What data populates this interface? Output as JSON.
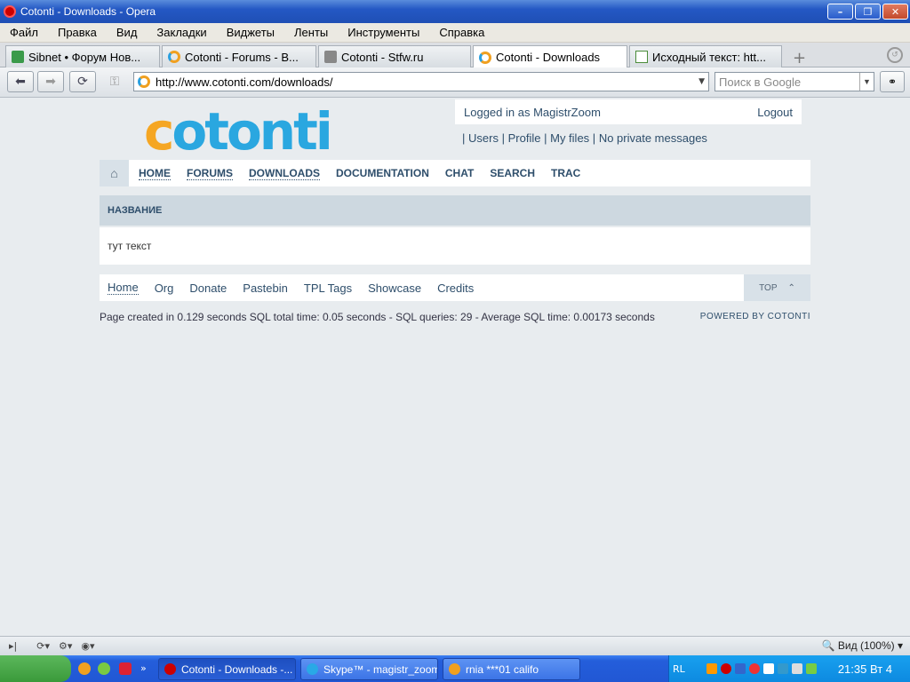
{
  "window": {
    "title": "Cotonti - Downloads - Opera"
  },
  "menu": [
    "Файл",
    "Правка",
    "Вид",
    "Закладки",
    "Виджеты",
    "Ленты",
    "Инструменты",
    "Справка"
  ],
  "tabs": [
    {
      "label": "Sibnet • Форум Нов..."
    },
    {
      "label": "Cotonti - Forums - B..."
    },
    {
      "label": "Cotonti - Stfw.ru"
    },
    {
      "label": "Cotonti - Downloads"
    },
    {
      "label": "Исходный текст: htt..."
    }
  ],
  "address": {
    "url": "http://www.cotonti.com/downloads/",
    "search_placeholder": "Поиск в Google"
  },
  "site": {
    "logo_text_1": "c",
    "logo_text_2": "otonti",
    "logged_in": "Logged in as MagistrZoom",
    "logout": "Logout",
    "user_links": {
      "sep": "|",
      "users": "Users",
      "profile": "Profile",
      "files": "My files",
      "messages": "No private messages"
    },
    "nav": [
      "HOME",
      "FORUMS",
      "DOWNLOADS",
      "DOCUMENTATION",
      "CHAT",
      "SEARCH",
      "TRAC"
    ],
    "section_header": "НАЗВАНИЕ",
    "content_text": "тут текст",
    "footer_nav": [
      "Home",
      "Org",
      "Donate",
      "Pastebin",
      "TPL Tags",
      "Showcase",
      "Credits"
    ],
    "top_label": "TOP",
    "stats": "Page created in 0.129 seconds SQL total time: 0.05 seconds - SQL queries: 29 - Average SQL time: 0.00173 seconds",
    "powered": "POWERED BY COTONTI"
  },
  "status": {
    "zoom": "Вид (100%)"
  },
  "taskbar": {
    "tasks": [
      "Cotonti - Downloads -...",
      "Skype™ - magistr_zoom",
      "rnia ***01 califo"
    ],
    "tray_lang": "RL",
    "clock": "21:35 Вт 4"
  }
}
